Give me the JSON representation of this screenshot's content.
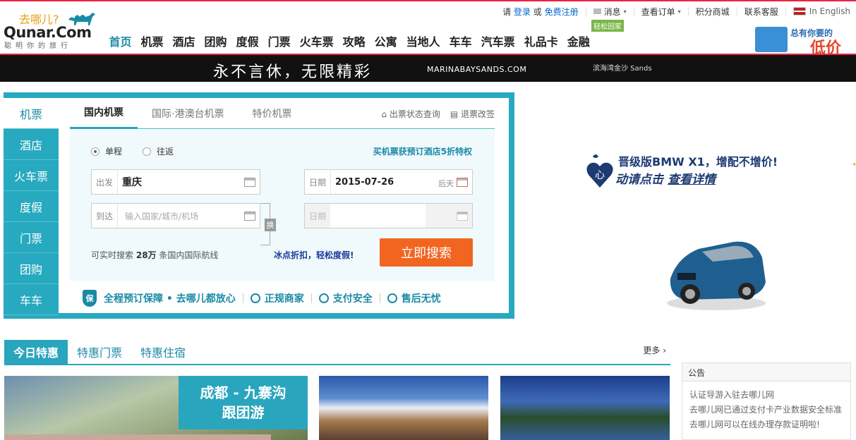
{
  "top": {
    "please": "请",
    "login": "登录",
    "or": "或",
    "register": "免费注册",
    "messages": "消息",
    "orders": "查看订单",
    "points_mall": "积分商城",
    "service": "联系客服",
    "language": "In English"
  },
  "logo": {
    "cn": "去哪儿?",
    "en": "Qunar.Com",
    "slogan": "聪明你的旅行"
  },
  "nav": {
    "items": [
      "首页",
      "机票",
      "酒店",
      "团购",
      "度假",
      "门票",
      "火车票",
      "攻略",
      "公寓",
      "当地人",
      "车车",
      "汽车票",
      "礼品卡",
      "金融"
    ],
    "badge": "轻松回家"
  },
  "top_ad": {
    "t1": "总有你要的",
    "t2": "低价"
  },
  "banner": {
    "text": "永不言休，无限精彩",
    "url": "MARINABAYSANDS.COM",
    "brand": "滨海湾金沙 Sands"
  },
  "search": {
    "side_tabs": [
      "机票",
      "酒店",
      "火车票",
      "度假",
      "门票",
      "团购",
      "车车"
    ],
    "tabs": [
      "国内机票",
      "国际·港澳台机票",
      "特价机票"
    ],
    "links": [
      "出票状态查询",
      "退票改签"
    ],
    "trip_one_way": "单程",
    "trip_round": "往返",
    "promo_hotel": "买机票获预订酒店5折特权",
    "from_label": "出发",
    "from_value": "重庆",
    "to_label": "到达",
    "to_placeholder": "输入国家/城市/机场",
    "date_label": "日期",
    "date_value": "2015-07-26",
    "date_aux": "后天",
    "return_label": "日期",
    "swap": "换",
    "info_prefix": "可实时搜索",
    "info_count": "28万",
    "info_suffix": "条国内国际航线",
    "promo_cool": "冰点折扣，轻松度假!",
    "search_button": "立即搜索",
    "guarantees": [
      "全程预订保障 • 去哪儿都放心",
      "正规商家",
      "支付安全",
      "售后无忧"
    ],
    "shield": "保"
  },
  "bmw_ad": {
    "t1": "晋级版BMW X1，增配不增价!",
    "t2": "动请点击",
    "link": "查看详情"
  },
  "deals": {
    "tabs": [
      "今日特惠",
      "特惠门票",
      "特惠住宿"
    ],
    "more": "更多 ›",
    "card1_caption_l1": "成都 - 九寨沟",
    "card1_caption_l2": "跟团游"
  },
  "notice": {
    "title": "公告",
    "lines": [
      "认证导游入驻去哪儿网",
      "去哪儿网已通过支付卡产业数据安全标准",
      "去哪儿网可以在线办理存款证明啦!"
    ]
  }
}
